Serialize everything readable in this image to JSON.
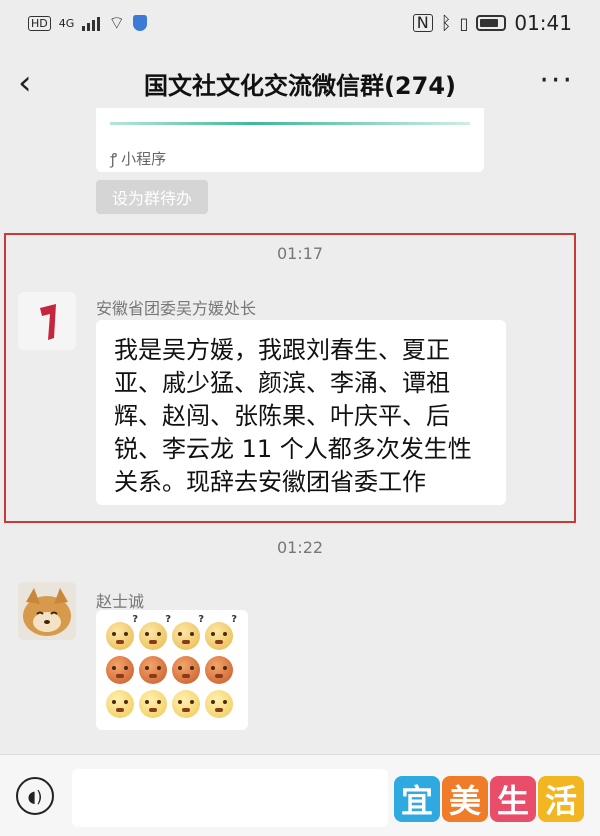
{
  "status_bar": {
    "hd_label": "HD",
    "network": "4G",
    "time": "01:41"
  },
  "header": {
    "back_glyph": "‹",
    "title": "国文社文化交流微信群(274)",
    "more_glyph": "···"
  },
  "mini_program": {
    "icon": "link-icon",
    "label": "小程序"
  },
  "todo_button": "设为群待办",
  "messages": [
    {
      "time": "01:17",
      "sender": "安徽省团委吴方媛处长",
      "text": "我是吴方媛，我跟刘春生、夏正亚、戚少猛、颜滨、李涌、谭祖辉、赵闯、张陈果、叶庆平、后锐、李云龙 11 个人都多次发生性关系。现辞去安徽团省委工作"
    },
    {
      "time": "01:22",
      "sender": "赵士诚",
      "emoji_rows": [
        [
          "confused",
          "confused",
          "confused",
          "confused"
        ],
        [
          "angry",
          "angry",
          "angry",
          "angry"
        ],
        [
          "shocked",
          "shocked",
          "shocked",
          "shocked"
        ]
      ]
    }
  ],
  "input_bar": {
    "voice_icon": "voice-icon",
    "placeholder": ""
  },
  "watermark": {
    "chars": [
      "宜",
      "美",
      "生",
      "活"
    ],
    "colors": [
      "#2fa9e0",
      "#f07c2a",
      "#e84e6a",
      "#f2b622"
    ]
  }
}
